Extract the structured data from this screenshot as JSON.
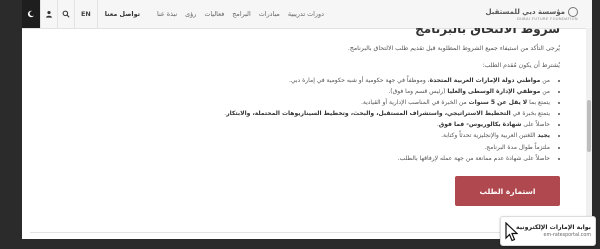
{
  "nav": {
    "theme_icon": "moon-icon",
    "user_icon": "user-icon",
    "search_icon": "search-icon",
    "lang": "EN",
    "contact": "تواصل معنا",
    "links": [
      "دورات تدريبية",
      "مبادرات",
      "البرامج",
      "فعاليات",
      "رؤى",
      "نبذة عنا"
    ],
    "logo_ar": "مؤسسة دبي للمستقبل",
    "logo_en": "DUBAI FUTURE FOUNDATION"
  },
  "content": {
    "heading": "شروط الالتحاق بالبرنامج",
    "intro": "يُرجى التأكد من استيفاء جميع الشروط المطلوبة قبل تقديم طلب الالتحاق بالبرنامج.",
    "conditions_title": "يُشترط أن يكون مُقدم الطلب:",
    "requirements": [
      {
        "pre": "من ",
        "bold": "مواطني دولة الإمارات العربية المتحدة",
        "post": "، وموظفاً في جهة حكومية أو شبه حكومية في إمارة دبي."
      },
      {
        "pre": "من ",
        "bold": "موظفي الإدارة الوسطى والعليا",
        "post": " (رئيس قسم وما فوق)."
      },
      {
        "pre": "يتمتع بما ",
        "bold": "لا يقل عن 5 سنوات",
        "post": " من الخبرة في المناصب الإدارية أو القيادية."
      },
      {
        "pre": "يتمتع بخبرة في ",
        "bold": "التخطيط الاستراتيجي، واستشراف المستقبل، والبحث، وتخطيط السيناريوهات المحتملة، والابتكار",
        "post": "."
      },
      {
        "pre": "حاصلاً على ",
        "bold": "شهادة بكالوريوس- فما فوق",
        "post": "."
      },
      {
        "pre": "",
        "bold": "يجيد",
        "post": " اللغتين العربية والإنجليزية تحدثاً وكتابة."
      },
      {
        "pre": "",
        "bold": "",
        "post": "ملتزماً طوال مدة البرنامج."
      },
      {
        "pre": "",
        "bold": "",
        "post": "حاصلاً على شهادة عدم ممانعة من جهة عمله لإرفاقها بالطلب."
      }
    ],
    "apply_button": "استمارة الطلب"
  },
  "watermark": {
    "ar": "بوابة الإمارات الإلكترونية",
    "en": "em-ratesportal.com"
  },
  "colors": {
    "button": "#b0484f",
    "navbar": "#f6f6f6"
  }
}
